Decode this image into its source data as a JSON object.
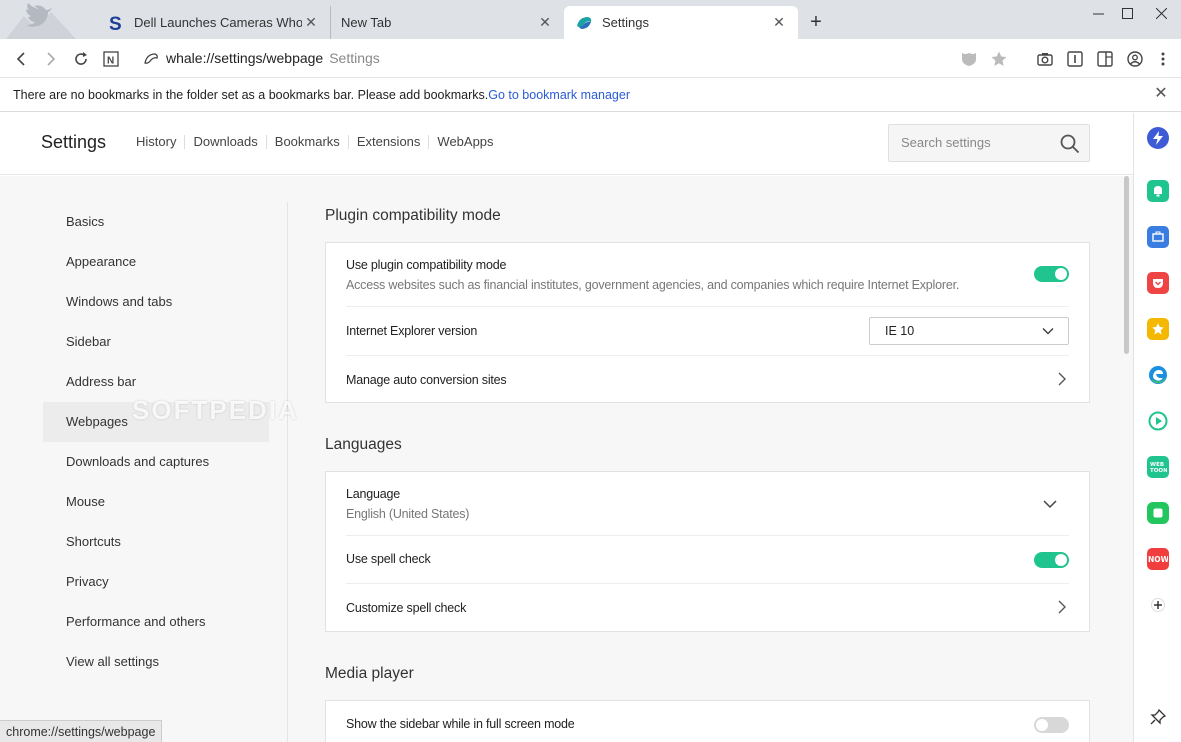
{
  "tabs": [
    {
      "title": "Dell Launches Cameras Whose",
      "favicon": "softpedia-s-icon"
    },
    {
      "title": "New Tab",
      "favicon": ""
    },
    {
      "title": "Settings",
      "favicon": "whale-icon"
    }
  ],
  "address_bar": {
    "url": "whale://settings/webpage",
    "page_title": "Settings"
  },
  "bookmarks_bar": {
    "message": "There are no bookmarks in the folder set as a bookmarks bar. Please add bookmarks.",
    "link": "Go to bookmark manager"
  },
  "header": {
    "title": "Settings",
    "nav": [
      "History",
      "Downloads",
      "Bookmarks",
      "Extensions",
      "WebApps"
    ],
    "search_placeholder": "Search settings"
  },
  "sidebar_nav": [
    {
      "label": "Basics"
    },
    {
      "label": "Appearance"
    },
    {
      "label": "Windows and tabs"
    },
    {
      "label": "Sidebar"
    },
    {
      "label": "Address bar"
    },
    {
      "label": "Webpages",
      "active": true
    },
    {
      "label": "Downloads and captures"
    },
    {
      "label": "Mouse"
    },
    {
      "label": "Shortcuts"
    },
    {
      "label": "Privacy"
    },
    {
      "label": "Performance and others"
    },
    {
      "label": "View all settings"
    }
  ],
  "sections": {
    "plugin": {
      "title": "Plugin compatibility mode",
      "use_label": "Use plugin compatibility mode",
      "use_desc": "Access websites such as financial institutes, government agencies, and companies which require Internet Explorer.",
      "use_enabled": true,
      "ie_label": "Internet Explorer version",
      "ie_value": "IE 10",
      "manage_label": "Manage auto conversion sites"
    },
    "languages": {
      "title": "Languages",
      "language_label": "Language",
      "language_value": "English (United States)",
      "spell_label": "Use spell check",
      "spell_enabled": true,
      "customize_label": "Customize spell check"
    },
    "media": {
      "title": "Media player",
      "fullscreen_label": "Show the sidebar while in full screen mode",
      "fullscreen_enabled": false
    }
  },
  "status_bar": "chrome://settings/webpage",
  "watermark": "SOFTPEDIA",
  "colors": {
    "accent_toggle": "#1fc48e",
    "link": "#2a5bd7"
  }
}
